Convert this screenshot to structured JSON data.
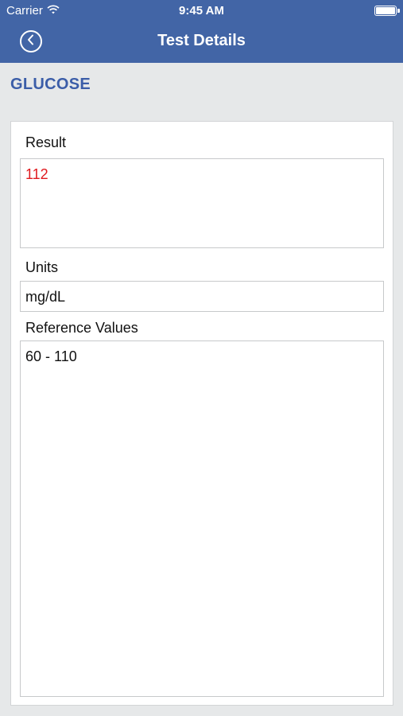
{
  "status_bar": {
    "carrier": "Carrier",
    "time": "9:45 AM",
    "battery_level": 1.0
  },
  "nav": {
    "title": "Test Details",
    "back_icon": "chevron-left-circle-icon"
  },
  "test": {
    "name": "GLUCOSE"
  },
  "fields": {
    "result_label": "Result",
    "result_value": "112",
    "units_label": "Units",
    "units_value": "mg/dL",
    "reference_label": "Reference Values",
    "reference_value": "60 - 110"
  },
  "colors": {
    "nav_bar": "#4265a6",
    "test_name": "#3b5da8",
    "result_value": "#e0191e",
    "background": "#e6e8e9"
  }
}
